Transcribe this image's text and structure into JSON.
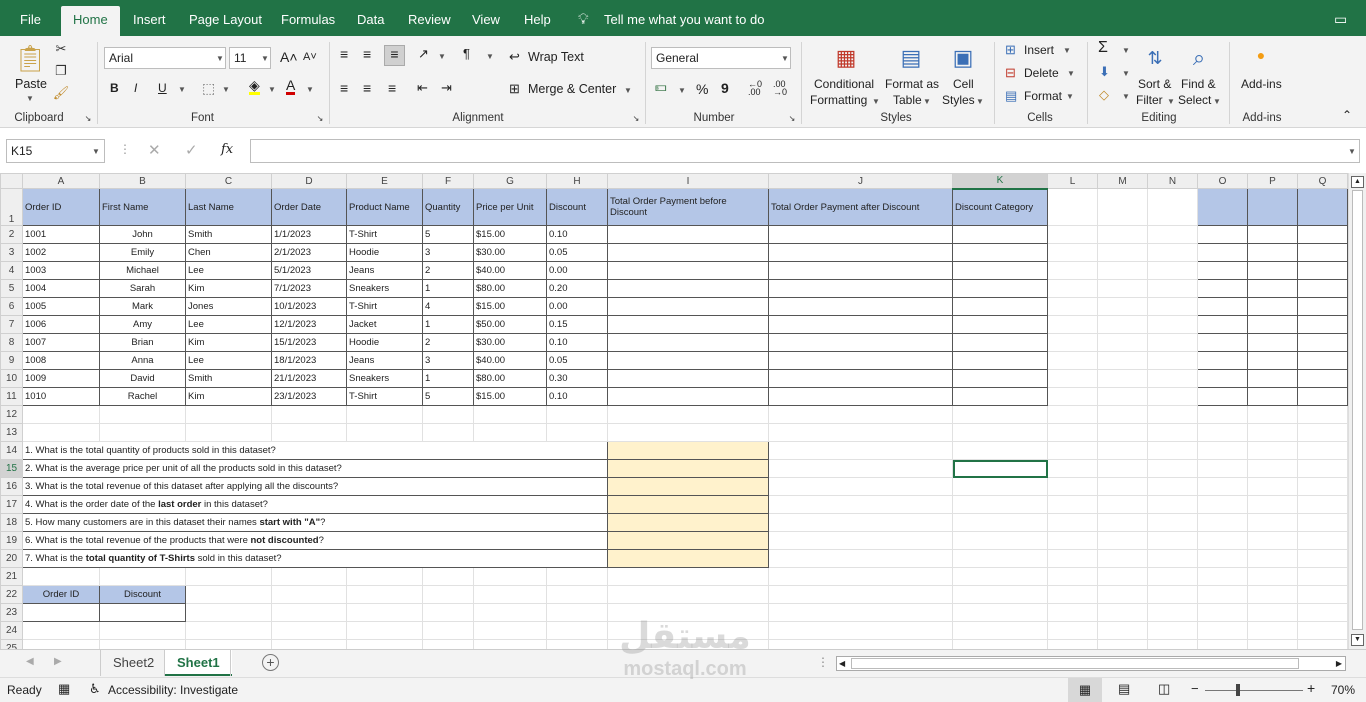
{
  "menu": {
    "tabs": [
      "File",
      "Home",
      "Insert",
      "Page Layout",
      "Formulas",
      "Data",
      "Review",
      "View",
      "Help"
    ],
    "tell_me": "Tell me what you want to do"
  },
  "ribbon": {
    "clipboard": {
      "paste": "Paste",
      "label": "Clipboard"
    },
    "font": {
      "name": "Arial",
      "size": "11",
      "bold": "B",
      "italic": "I",
      "underline": "U",
      "label": "Font"
    },
    "alignment": {
      "wrap_text": "Wrap Text",
      "merge_center": "Merge & Center",
      "label": "Alignment"
    },
    "number": {
      "format": "General",
      "percent": "%",
      "comma": "9",
      "label": "Number"
    },
    "styles": {
      "conditional": "Conditional",
      "conditional2": "Formatting",
      "format_as": "Format as",
      "format_as2": "Table",
      "cell": "Cell",
      "cell2": "Styles",
      "label": "Styles"
    },
    "cells": {
      "insert": "Insert",
      "delete": "Delete",
      "format": "Format",
      "label": "Cells"
    },
    "editing": {
      "sort": "Sort &",
      "sort2": "Filter",
      "find": "Find &",
      "find2": "Select",
      "label": "Editing"
    },
    "addins": {
      "btn": "Add-ins",
      "label": "Add-ins"
    }
  },
  "formula_bar": {
    "name_box": "K15",
    "fx": "fx",
    "formula": ""
  },
  "columns": [
    "A",
    "B",
    "C",
    "D",
    "E",
    "F",
    "G",
    "H",
    "I",
    "J",
    "K",
    "L",
    "M",
    "N",
    "O",
    "P",
    "Q"
  ],
  "selected_cell": {
    "col": "K",
    "row": "15"
  },
  "headers": [
    "Order ID",
    "First Name",
    "Last Name",
    "Order Date",
    "Product Name",
    "Quantity",
    "Price per Unit",
    "Discount",
    "Total Order Payment before Discount",
    "Total Order Payment after Discount",
    "Discount Category"
  ],
  "rows": [
    [
      "1001",
      "John",
      "Smith",
      "1/1/2023",
      "T-Shirt",
      "5",
      "$15.00",
      "0.10"
    ],
    [
      "1002",
      "Emily",
      "Chen",
      "2/1/2023",
      "Hoodie",
      "3",
      "$30.00",
      "0.05"
    ],
    [
      "1003",
      "Michael",
      "Lee",
      "5/1/2023",
      "Jeans",
      "2",
      "$40.00",
      "0.00"
    ],
    [
      "1004",
      "Sarah",
      "Kim",
      "7/1/2023",
      "Sneakers",
      "1",
      "$80.00",
      "0.20"
    ],
    [
      "1005",
      "Mark",
      "Jones",
      "10/1/2023",
      "T-Shirt",
      "4",
      "$15.00",
      "0.00"
    ],
    [
      "1006",
      "Amy",
      "Lee",
      "12/1/2023",
      "Jacket",
      "1",
      "$50.00",
      "0.15"
    ],
    [
      "1007",
      "Brian",
      "Kim",
      "15/1/2023",
      "Hoodie",
      "2",
      "$30.00",
      "0.10"
    ],
    [
      "1008",
      "Anna",
      "Lee",
      "18/1/2023",
      "Jeans",
      "3",
      "$40.00",
      "0.05"
    ],
    [
      "1009",
      "David",
      "Smith",
      "21/1/2023",
      "Sneakers",
      "1",
      "$80.00",
      "0.30"
    ],
    [
      "1010",
      "Rachel",
      "Kim",
      "23/1/2023",
      "T-Shirt",
      "5",
      "$15.00",
      "0.10"
    ]
  ],
  "questions": [
    {
      "parts": [
        "1. What is the total quantity of products sold in this dataset?"
      ]
    },
    {
      "parts": [
        "2. What is the average price per unit of all the products sold in this dataset?"
      ]
    },
    {
      "parts": [
        "3. What is the total revenue of this dataset after applying all the discounts?"
      ]
    },
    {
      "parts": [
        "4. What is the order date of the ",
        "last order",
        " in this dataset?"
      ]
    },
    {
      "parts": [
        "5. How many customers are in this dataset their names ",
        "start with \"A\"",
        "?"
      ]
    },
    {
      "parts": [
        "6. What is the total revenue of the products that were ",
        "not discounted",
        "?"
      ]
    },
    {
      "parts": [
        "7. What is the ",
        "total quantity of T-Shirts",
        " sold in this dataset?"
      ]
    }
  ],
  "lookup_headers": [
    "Order ID",
    "Discount"
  ],
  "sheets": [
    "Sheet2",
    "Sheet1"
  ],
  "active_sheet": "Sheet1",
  "status": {
    "ready": "Ready",
    "accessibility": "Accessibility: Investigate",
    "zoom": "70%"
  },
  "watermark": {
    "arabic": "مستقل",
    "latin": "mostaql.com"
  }
}
